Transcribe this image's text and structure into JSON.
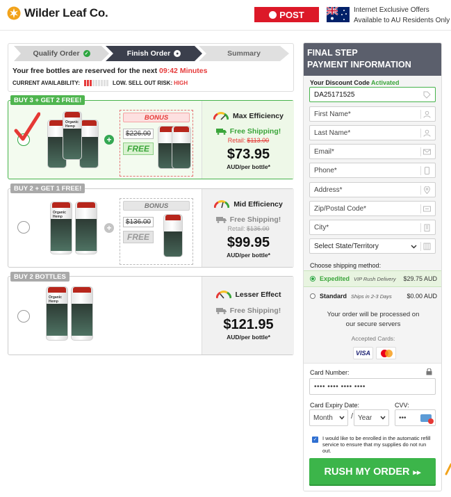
{
  "brand": {
    "name": "Wilder Leaf Co."
  },
  "header": {
    "auspost_label": "POST",
    "offers_line1": "Internet Exclusive Offers",
    "offers_line2": "Available to AU Residents Only"
  },
  "steps": [
    "Qualify Order",
    "Finish Order",
    "Summary"
  ],
  "reserve": {
    "text": "Your free bottles are reserved for the next",
    "timer": "09:42 Minutes"
  },
  "availability": {
    "label": "CURRENT AVAILABILITY:",
    "risk_label": "LOW. SELL OUT RISK:",
    "risk_value": "HIGH",
    "level_filled": 3,
    "level_total": 9
  },
  "packages": [
    {
      "badge": "BUY 3 + GET 2 FREE!",
      "selected": true,
      "bonus_label": "BONUS",
      "bonus_old_price": "$226.00",
      "bonus_free": "FREE",
      "efficiency": "Max Efficiency",
      "shipping": "Free Shipping!",
      "retail_label": "Retail:",
      "retail_price": "$113.00",
      "price": "$73.95",
      "per": "AUD/per bottle*"
    },
    {
      "badge": "BUY 2 + GET 1 FREE!",
      "selected": false,
      "bonus_label": "BONUS",
      "bonus_old_price": "$136.00",
      "bonus_free": "FREE",
      "efficiency": "Mid Efficiency",
      "shipping": "Free Shipping!",
      "retail_label": "Retail:",
      "retail_price": "$136.00",
      "price": "$99.95",
      "per": "AUD/per bottle*"
    },
    {
      "badge": "BUY 2 BOTTLES",
      "selected": false,
      "efficiency": "Lesser Effect",
      "shipping": "Free Shipping!",
      "price": "$121.95",
      "per": "AUD/per bottle*"
    }
  ],
  "bottle_label": {
    "brand": "Wilder Leaf Co.",
    "name": "Organic Hemp"
  },
  "payment": {
    "title_line1": "FINAL STEP",
    "title_line2": "PAYMENT INFORMATION",
    "discount_label": "Your Discount Code",
    "discount_status": "Activated",
    "discount_code": "DA25171525",
    "first_name": "First Name*",
    "last_name": "Last Name*",
    "email": "Email*",
    "phone": "Phone*",
    "address": "Address*",
    "zip": "Zip/Postal Code*",
    "city": "City*",
    "state": "Select State/Territory",
    "shipping_method_label": "Choose shipping method:",
    "shipping_options": [
      {
        "name": "Expedited",
        "desc": "VIP Rush Delivery",
        "price": "$29.75 AUD",
        "selected": true
      },
      {
        "name": "Standard",
        "desc": "Ships in 2-3 Days",
        "price": "$0.00 AUD",
        "selected": false
      }
    ],
    "processed_line1": "Your order will be processed on",
    "processed_line2": "our secure servers",
    "accepted_cards": "Accepted Cards:",
    "visa": "VISA",
    "card_number_label": "Card Number:",
    "card_number_placeholder": "•••• •••• •••• ••••",
    "expiry_label": "Card Expiry Date:",
    "cvv_label": "CVV:",
    "month": "Month",
    "year": "Year",
    "slash": "/",
    "cvv_placeholder": "•••",
    "autorefill_text": "I would like to be enrolled in the automatic refill service to ensure that my supplies do not run out.",
    "rush_button": "RUSH MY ORDER",
    "rush_arrows": "▸▸"
  },
  "colors": {
    "accent_green": "#3cb54a",
    "alert_red": "#e63b3b",
    "panel_dark": "#5b5f6c"
  }
}
